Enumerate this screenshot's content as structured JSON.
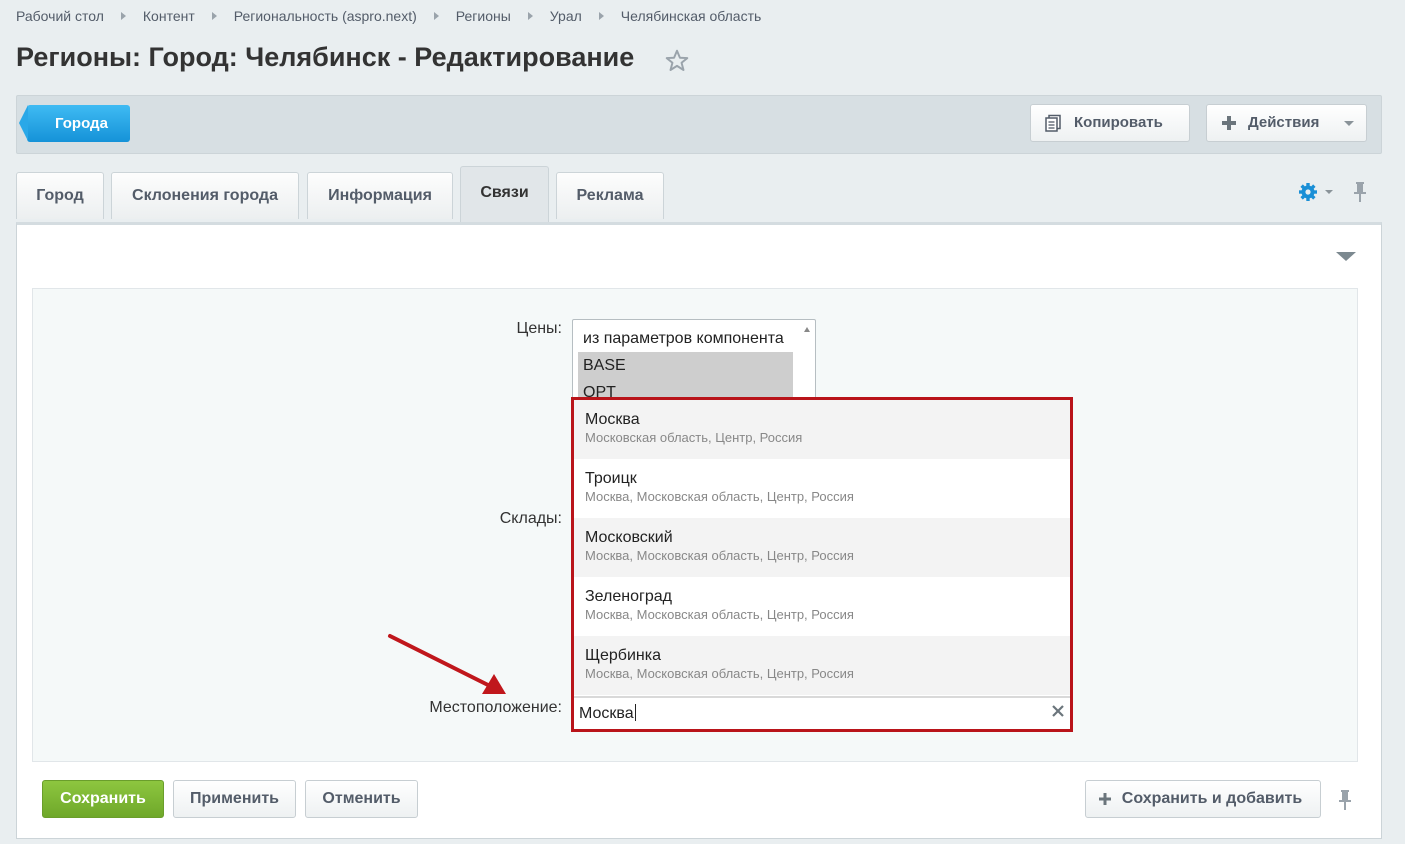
{
  "breadcrumbs": [
    "Рабочий стол",
    "Контент",
    "Региональность (aspro.next)",
    "Регионы",
    "Урал",
    "Челябинская область"
  ],
  "page_title": "Регионы: Город: Челябинск - Редактирование",
  "toolbar": {
    "back_label": "Города",
    "copy_label": "Копировать",
    "actions_label": "Действия"
  },
  "tabs": [
    {
      "label": "Город",
      "active": false
    },
    {
      "label": "Склонения города",
      "active": false
    },
    {
      "label": "Информация",
      "active": false
    },
    {
      "label": "Связи",
      "active": true
    },
    {
      "label": "Реклама",
      "active": false
    }
  ],
  "form": {
    "prices_label": "Цены:",
    "prices_options": [
      "из параметров компонента",
      "BASE",
      "OPT"
    ],
    "stores_label": "Склады:",
    "location_label": "Местоположение:",
    "location_value": "Москва"
  },
  "suggestions": [
    {
      "title": "Москва",
      "subtitle": "Московская область, Центр, Россия"
    },
    {
      "title": "Троицк",
      "subtitle": "Москва, Московская область, Центр, Россия"
    },
    {
      "title": "Московский",
      "subtitle": "Москва, Московская область, Центр, Россия"
    },
    {
      "title": "Зеленоград",
      "subtitle": "Москва, Московская область, Центр, Россия"
    },
    {
      "title": "Щербинка",
      "subtitle": "Москва, Московская область, Центр, Россия"
    }
  ],
  "footer": {
    "save_label": "Сохранить",
    "apply_label": "Применить",
    "cancel_label": "Отменить",
    "save_add_label": "Сохранить и добавить"
  },
  "colors": {
    "accent_blue": "#1592d8",
    "save_green": "#7ab534",
    "highlight_red": "#b9141a",
    "annotation_red": "#c0171c"
  }
}
